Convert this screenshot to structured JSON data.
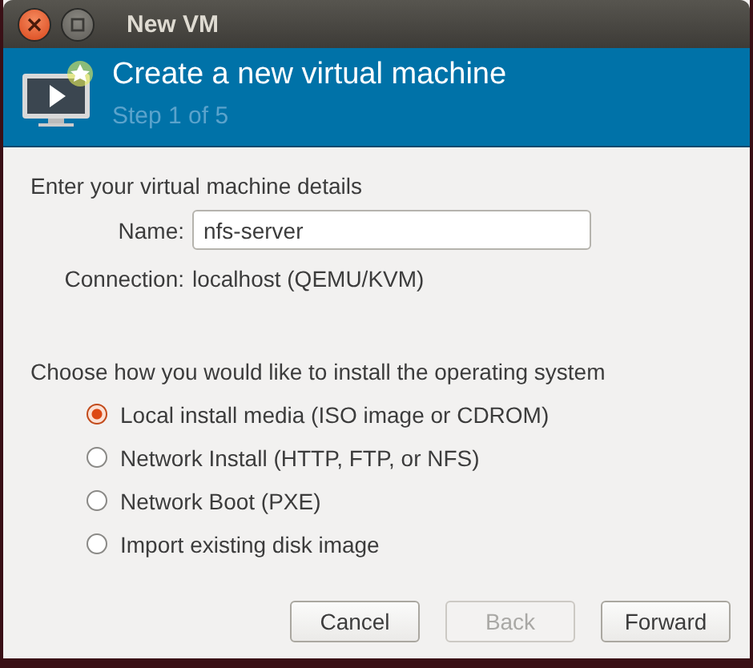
{
  "window": {
    "title": "New VM"
  },
  "header": {
    "title": "Create a new virtual machine",
    "subtitle": "Step 1 of 5"
  },
  "details": {
    "heading": "Enter your virtual machine details",
    "name_label": "Name:",
    "name_value": "nfs-server",
    "connection_label": "Connection:",
    "connection_value": "localhost (QEMU/KVM)"
  },
  "install": {
    "heading": "Choose how you would like to install the operating system",
    "options": [
      {
        "label": "Local install media (ISO image or CDROM)",
        "selected": true
      },
      {
        "label": "Network Install (HTTP, FTP, or NFS)",
        "selected": false
      },
      {
        "label": "Network Boot (PXE)",
        "selected": false
      },
      {
        "label": "Import existing disk image",
        "selected": false
      }
    ]
  },
  "buttons": [
    {
      "label": "Cancel",
      "disabled": false
    },
    {
      "label": "Back",
      "disabled": true
    },
    {
      "label": "Forward",
      "disabled": false
    }
  ]
}
